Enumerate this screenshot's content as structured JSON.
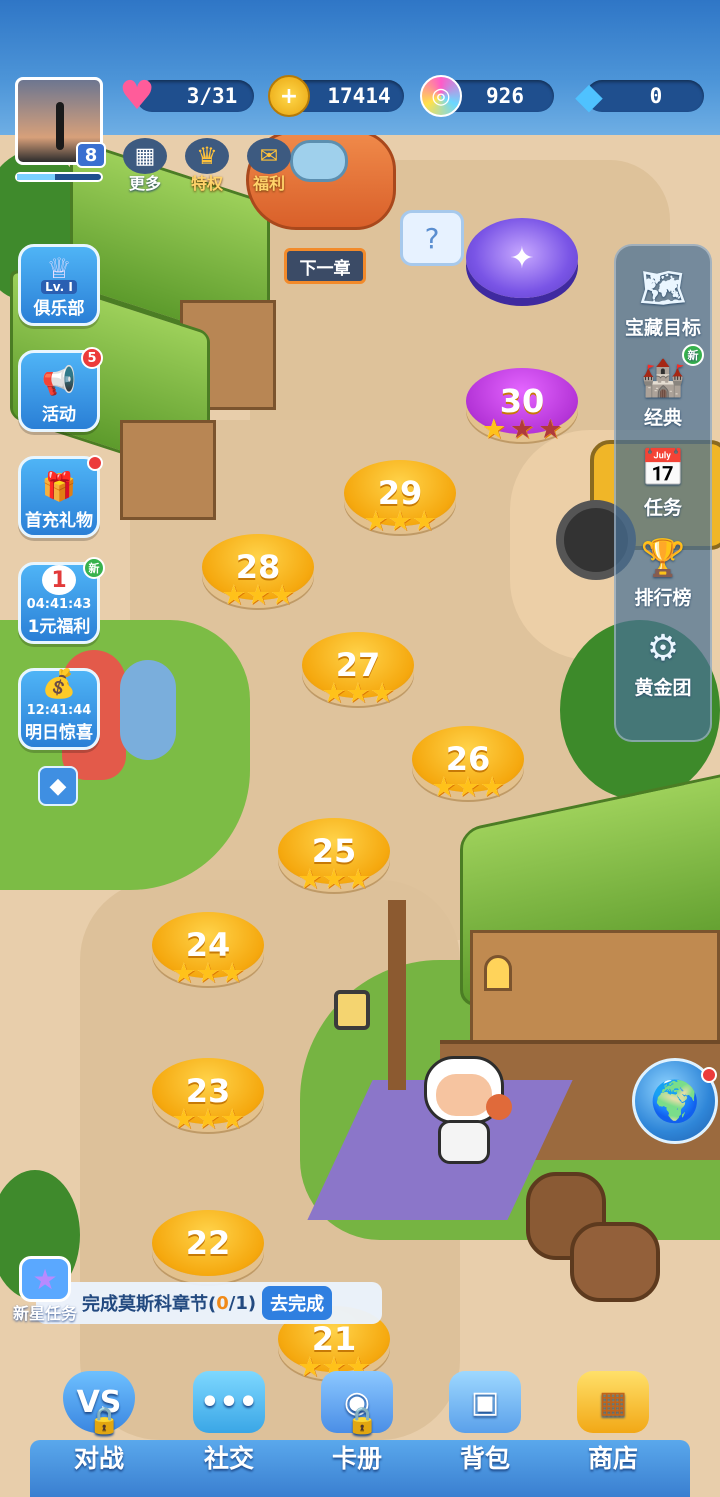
{
  "player": {
    "level": "8"
  },
  "resources": {
    "hearts": "3/31",
    "gold": "17414",
    "energy": "926",
    "diamonds": "0"
  },
  "top_menu": [
    {
      "label": "更多",
      "icon": "grid-icon"
    },
    {
      "label": "特权",
      "icon": "crown-icon"
    },
    {
      "label": "福利",
      "icon": "gift-icon"
    }
  ],
  "next_chapter": "下一章",
  "left_buttons": {
    "club": {
      "label": "俱乐部",
      "badge": "Lv. I"
    },
    "activity": {
      "label": "活动",
      "badge": "5"
    },
    "first_charge": {
      "label": "首充礼物"
    },
    "yuan_welfare": {
      "label": "1元福利",
      "timer": "04:41:43",
      "badge": "新"
    },
    "tomorrow": {
      "label": "明日惊喜",
      "timer": "12:41:44"
    }
  },
  "right_panel": [
    {
      "label": "宝藏目标",
      "icon": "treasure-map-icon"
    },
    {
      "label": "经典",
      "icon": "castle-icon",
      "badge": "新"
    },
    {
      "label": "任务",
      "icon": "calendar-icon"
    },
    {
      "label": "排行榜",
      "icon": "podium-icon"
    },
    {
      "label": "黄金团",
      "icon": "helm-lock-icon"
    }
  ],
  "levels": [
    {
      "num": "30",
      "stars": 1,
      "current": true
    },
    {
      "num": "29",
      "stars": 3
    },
    {
      "num": "28",
      "stars": 3
    },
    {
      "num": "27",
      "stars": 3
    },
    {
      "num": "26",
      "stars": 3
    },
    {
      "num": "25",
      "stars": 3
    },
    {
      "num": "24",
      "stars": 3
    },
    {
      "num": "23",
      "stars": 3
    },
    {
      "num": "22",
      "stars": 3
    },
    {
      "num": "21",
      "stars": 3
    }
  ],
  "star_task": {
    "badge": "新星任务",
    "text_prefix": "完成莫斯科章节(",
    "progress": "0",
    "text_suffix": "/1)",
    "button": "去完成"
  },
  "bottom_nav": [
    {
      "label": "对战",
      "icon": "vs-shield-icon",
      "locked": true
    },
    {
      "label": "社交",
      "icon": "chat-icon"
    },
    {
      "label": "卡册",
      "icon": "balloon-album-icon",
      "locked": true
    },
    {
      "label": "背包",
      "icon": "backpack-icon"
    },
    {
      "label": "商店",
      "icon": "shop-icon"
    }
  ],
  "colors": {
    "accent_blue": "#2f76c6",
    "level_gold": "#f5a80e",
    "level_purple": "#b535d8",
    "star": "#ffc21a"
  }
}
